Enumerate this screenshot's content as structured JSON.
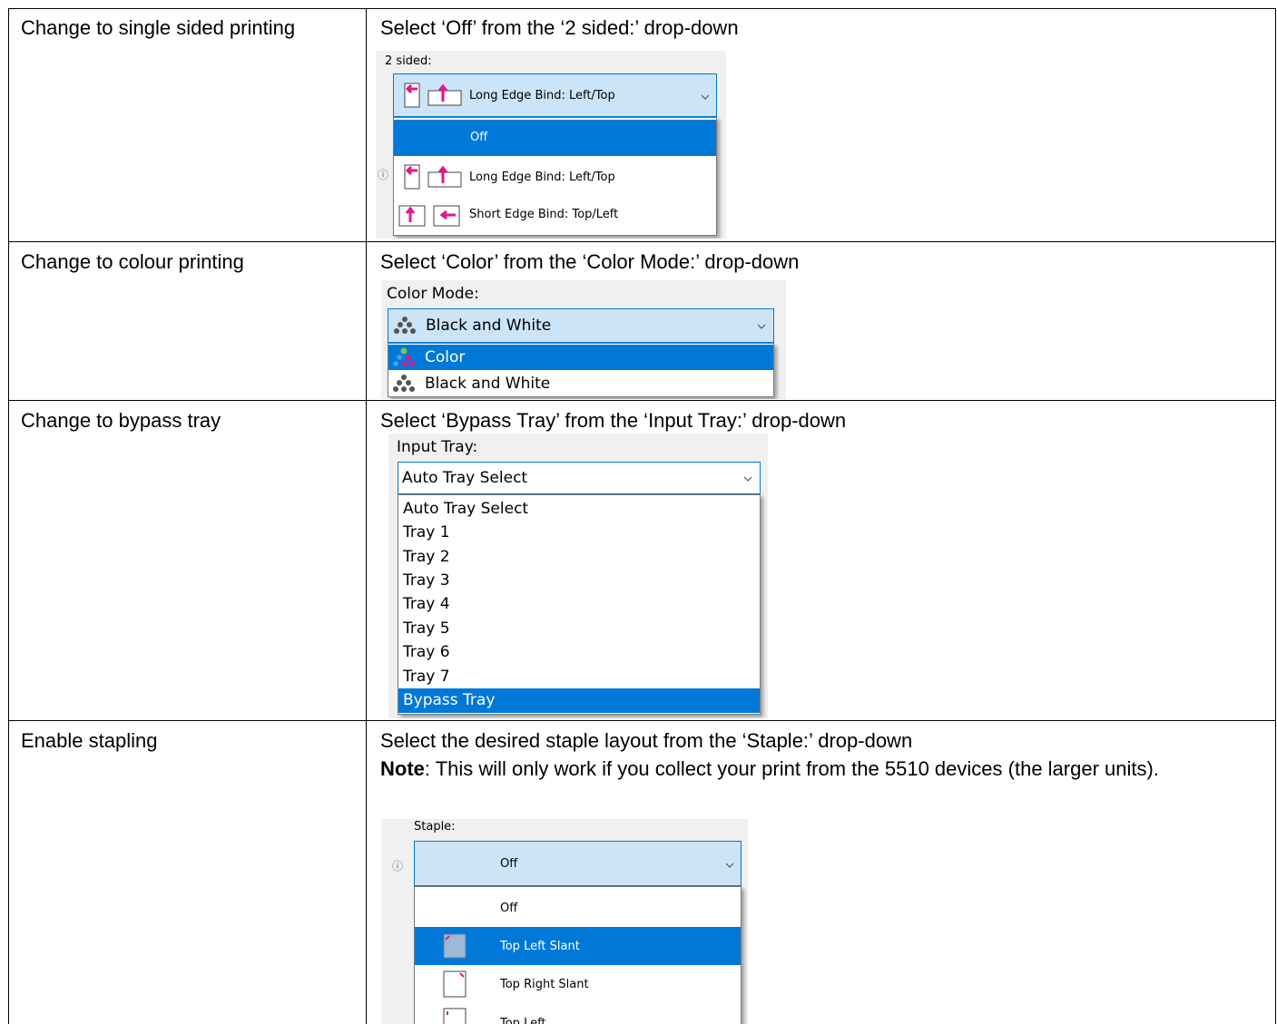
{
  "rows": [
    {
      "task": "Change to single sided printing",
      "instruction": "Select ‘Off’ from the ‘2 sided:’ drop-down",
      "shot": {
        "label": "2 sided:",
        "selected_value": "Long Edge Bind: Left/Top",
        "options": [
          "Off",
          "Long Edge Bind: Left/Top",
          "Short Edge Bind: Top/Left"
        ],
        "highlighted": "Off"
      }
    },
    {
      "task": "Change to colour printing",
      "instruction": "Select ‘Color’ from the ‘Color Mode:’ drop-down",
      "shot": {
        "label": "Color Mode:",
        "selected_value": "Black and White",
        "options": [
          "Color",
          "Black and White"
        ],
        "highlighted": "Color"
      }
    },
    {
      "task": "Change to bypass tray",
      "instruction": "Select ‘Bypass Tray’ from the ‘Input Tray:’ drop-down",
      "shot": {
        "label": "Input Tray:",
        "selected_value": "Auto Tray Select",
        "options": [
          "Auto Tray Select",
          "Tray 1",
          "Tray 2",
          "Tray 3",
          "Tray 4",
          "Tray 5",
          "Tray 6",
          "Tray 7",
          "Bypass Tray"
        ],
        "highlighted": "Bypass Tray"
      }
    },
    {
      "task": "Enable stapling",
      "instruction": "Select the desired staple layout from the ‘Staple:’ drop-down",
      "note_label": "Note",
      "note_text": ": This will only work if you collect your print from the 5510 devices (the larger units).",
      "shot": {
        "label": "Staple:",
        "selected_value": "Off",
        "options": [
          "Off",
          "Top Left Slant",
          "Top Right Slant",
          "Top Left"
        ],
        "highlighted": "Top Left Slant"
      }
    }
  ],
  "colors": {
    "highlight": "#0078d7",
    "combo_fill": "#cce4f7",
    "icon_magenta": "#e0168c"
  }
}
